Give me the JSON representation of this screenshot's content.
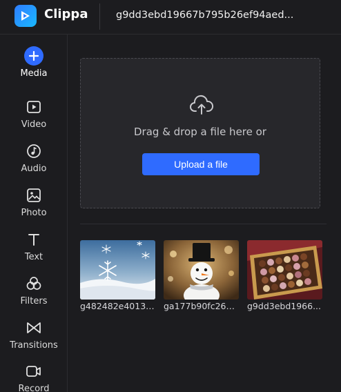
{
  "header": {
    "app_name": "Clippa",
    "project_title": "g9dd3ebd19667b795b26ef94aed..."
  },
  "sidebar": {
    "items": [
      {
        "label": "Media",
        "icon": "plus-circle-icon",
        "active": true
      },
      {
        "label": "Video",
        "icon": "video-icon"
      },
      {
        "label": "Audio",
        "icon": "music-note-icon"
      },
      {
        "label": "Photo",
        "icon": "photo-icon"
      },
      {
        "label": "Text",
        "icon": "text-icon"
      },
      {
        "label": "Filters",
        "icon": "filters-icon"
      },
      {
        "label": "Transitions",
        "icon": "transitions-icon"
      },
      {
        "label": "Record",
        "icon": "record-camera-icon"
      }
    ]
  },
  "upload": {
    "icon": "cloud-upload-icon",
    "drop_text": "Drag & drop a file here or",
    "button_label": "Upload a file"
  },
  "media": {
    "items": [
      {
        "name": "g482482e4013f...",
        "subject": "snowflakes"
      },
      {
        "name": "ga177b90fc26b...",
        "subject": "snowman"
      },
      {
        "name": "g9dd3ebd1966...",
        "subject": "chocolate truffles"
      }
    ]
  },
  "colors": {
    "accent": "#2f6bff",
    "background": "#1c1c1f",
    "panel": "#27272b"
  }
}
